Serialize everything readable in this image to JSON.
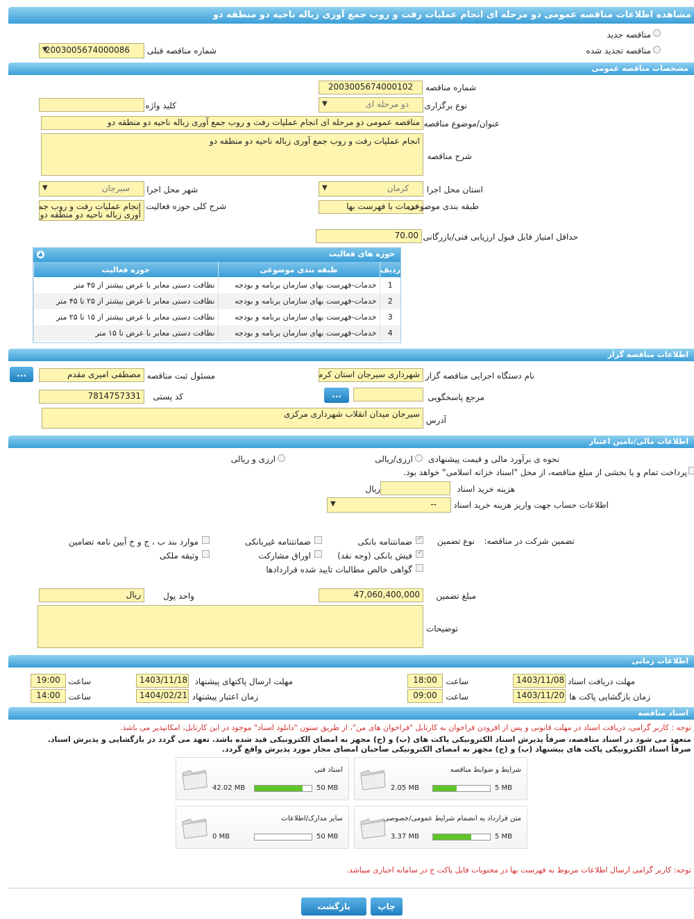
{
  "page_title": "مشاهده اطلاعات مناقصه عمومی دو مرحله ای انجام عملیات رفت و روب جمع آوری زباله ناحیه دو منطقه دو",
  "tender_type": {
    "new_label": "مناقصه جدید",
    "renewed_label": "مناقصه تجدید شده",
    "prev_number_label": "شماره مناقصه قبلی",
    "prev_number": "2003005674000086"
  },
  "general": {
    "header": "مشخصات مناقصه عمومی",
    "number_label": "شماره مناقصه",
    "number": "2003005674000102",
    "holding_type_label": "نوع برگزاری",
    "holding_type": "دو مرحله ای",
    "keyword_label": "کلید واژه",
    "keyword": "",
    "subject_label": "عنوان/موضوع مناقصه",
    "subject": "مناقصه عمومی دو مرحله ای انجام عملیات رفت و روب جمع آوری زباله ناحیه دو منطقه دو",
    "description_label": "شرح مناقصه",
    "description": "انجام عملیات رفت و روب جمع آوری زباله ناحیه دو منطقه دو",
    "province_label": "استان محل اجرا",
    "province": "کرمان",
    "city_label": "شهر محل اجرا",
    "city": "سیرجان",
    "category_label": "طبقه بندی موضوعی",
    "category": "خدمات با فهرست بها",
    "scope_label": "شرح کلی حوزه فعالیت",
    "scope_line1": "انجام عملیات رفت و روب جمع",
    "scope_line2": "آوری زباله ناحیه دو منطقه دو",
    "min_score_label": "حداقل امتیاز قابل قبول ارزیابی فنی/بازرگانی",
    "min_score": "70.00"
  },
  "activity_table": {
    "title": "حوزه های فعالیت",
    "headers": [
      "ردیف",
      "طبقه بندی موضوعی",
      "حوزه فعالیت"
    ],
    "rows": [
      [
        "1",
        "خدمات-فهرست بهای سازمان برنامه و بودجه",
        "نظافت دستی معابر با عرض بیشتر از ۴۵ متر"
      ],
      [
        "2",
        "خدمات-فهرست بهای سازمان برنامه و بودجه",
        "نظافت دستی معابر با عرض بیشتر از ۲۵ تا ۴۵ متر"
      ],
      [
        "3",
        "خدمات-فهرست بهای سازمان برنامه و بودجه",
        "نظافت دستی معابر با عرض بیشتر از ۱۵ تا ۲۵ متر"
      ],
      [
        "4",
        "خدمات-فهرست بهای سازمان برنامه و بودجه",
        "نظافت دستی معابر با عرض تا ۱۵ متر"
      ]
    ]
  },
  "organizer": {
    "header": "اطلاعات مناقصه گزار",
    "org_label": "نام دستگاه اجرایی مناقصه گزار",
    "org": "شهرداری سیرجان استان کرمان",
    "responsible_label": "مسئول ثبت مناقصه",
    "responsible": "مصطفی امیری مقدم",
    "reference_label": "مرجع پاسخگویی",
    "reference": "",
    "postal_label": "کد پستی",
    "postal": "7814757331",
    "address_label": "آدرس",
    "address": "سیرجان میدان انقلاب شهرداری مرکزی",
    "dots": "..."
  },
  "finance": {
    "header": "اطلاعات مالی/تامین اعتبار",
    "estimate_label": "نحوه ی برآورد مالی و قیمت پیشنهادی",
    "opt_rial": "ارزی/ریالی",
    "opt_fx": "ارزی و ریالی",
    "treasury_text": "پرداخت تمام و یا بخشی از مبلغ مناقصه، از محل \"اسناد خزانه اسلامی\" خواهد بود.",
    "doc_cost_label": "هزینه خرید اسناد",
    "doc_cost": "",
    "doc_cost_unit": "ریال",
    "account_label": "اطلاعات حساب جهت واریز هزینه خرید اسناد",
    "account": "--",
    "guarantee_label": "تضمین شرکت در مناقصه:",
    "guarantee_type_label": "نوع تضمین",
    "g_bank": "ضمانتنامه بانکی",
    "g_nonbank": "ضمانتنامه غیربانکی",
    "g_other": "موارد بند ب ، ج و خ آیین نامه تضامین",
    "g_cash": "فیش بانکی (وجه نقد)",
    "g_bonds": "اوراق مشارکت",
    "g_property": "وثیقه ملکی",
    "g_claims": "گواهی خالص مطالبات تایید شده قراردادها",
    "amount_label": "مبلغ تضمین",
    "amount": "47,060,400,000",
    "currency_label": "واحد پول",
    "currency": "ریال",
    "notes_label": "توضیحات",
    "notes": ""
  },
  "timing": {
    "header": "اطلاعات زمانی",
    "receive_label": "مهلت دریافت اسناد",
    "receive_date": "1403/11/08",
    "receive_time": "18:00",
    "send_label": "مهلت ارسال پاکتهای پیشنهاد",
    "send_date": "1403/11/18",
    "send_time": "19:00",
    "open_label": "زمان بازگشایی پاکت ها",
    "open_date": "1403/11/20",
    "open_time": "09:00",
    "validity_label": "زمان اعتبار پیشنهاد",
    "validity_date": "1404/02/21",
    "validity_time": "14:00",
    "time_label": "ساعت"
  },
  "documents": {
    "header": "اسناد مناقصه",
    "note1": "توجه : کاربر گرامی، دریافت اسناد در مهلت قانونی و پس از افزودن فراخوان به کارتابل \"فراخوان های من\"، از طریق ستون \"دانلود اسناد\" موجود در این کارتابل، امکانپذیر می باشد.",
    "note2": "متعهد می شود در اسناد مناقصه، صرفاً پذیرش اسناد الکترونیکی پاکت های (ب) و (ج) مجهز به امضای الکترونیکی قید شده باشد. تعهد می گردد در بازگشایی و پذیرش اسناد.",
    "note3": "صرفاً اسناد الکترونیکی پاکت های پیشنهاد (ب) و (ج) مجهز به امضای الکترونیکی صاحبان امضای مجاز مورد پذیرش واقع گردد.",
    "files": [
      {
        "name": "شرایط و ضوابط مناقصه",
        "used": "2.05 MB",
        "max": "5 MB",
        "fill": 0.41
      },
      {
        "name": "اسناد فنی",
        "used": "42.02 MB",
        "max": "50 MB",
        "fill": 0.84
      },
      {
        "name": "متن قرارداد به انضمام شرایط عمومی/خصوصی",
        "used": "3.37 MB",
        "max": "5 MB",
        "fill": 0.67
      },
      {
        "name": "سایر مدارک/اطلاعات",
        "used": "0 MB",
        "max": "50 MB",
        "fill": 0
      }
    ],
    "note4": "توجه: کاربر گرامی ارسال اطلاعات مربوط به فهرست بها در محتویات فایل پاکت ج در سامانه اجباری میباشد."
  },
  "buttons": {
    "print": "چاپ",
    "back": "بازگشت"
  },
  "colors": {
    "header_bar": "#3a9fd8",
    "input_bg": "#fdf5b0",
    "note_red": "#d32f2f",
    "progress": "#5ec42a"
  }
}
